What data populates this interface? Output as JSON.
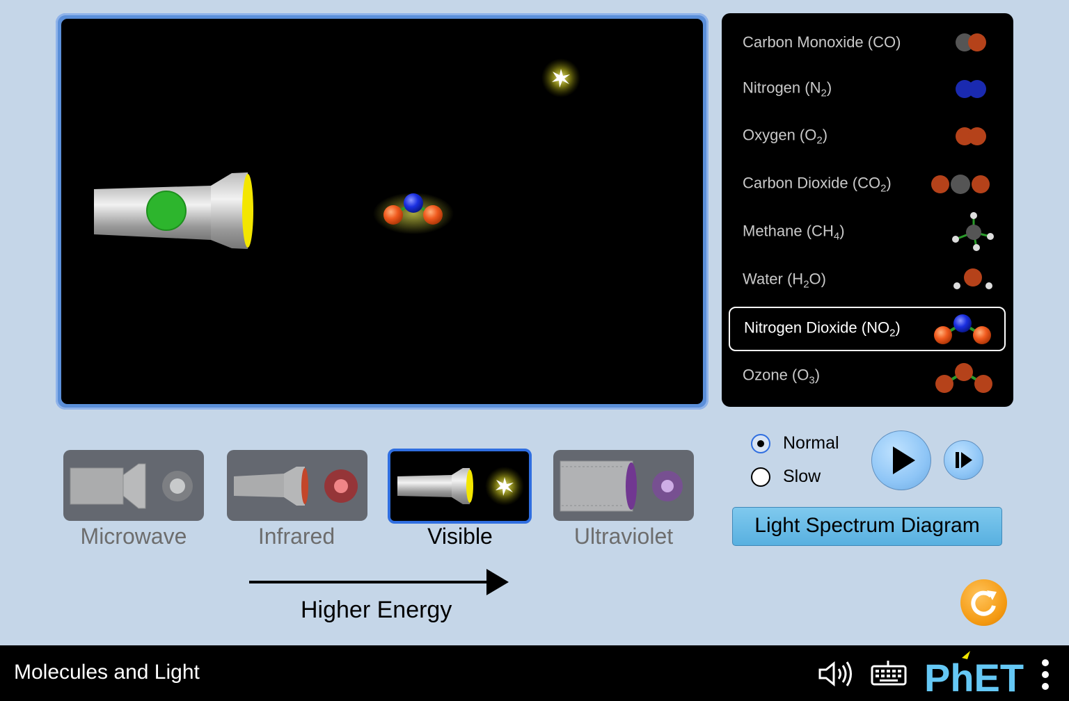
{
  "molecules": [
    {
      "label_main": "Carbon Monoxide (CO)",
      "label_sub": "",
      "label_end": "",
      "selected": false
    },
    {
      "label_main": "Nitrogen (N",
      "label_sub": "2",
      "label_end": ")",
      "selected": false
    },
    {
      "label_main": "Oxygen (O",
      "label_sub": "2",
      "label_end": ")",
      "selected": false
    },
    {
      "label_main": "Carbon Dioxide (CO",
      "label_sub": "2",
      "label_end": ")",
      "selected": false
    },
    {
      "label_main": "Methane (CH",
      "label_sub": "4",
      "label_end": ")",
      "selected": false
    },
    {
      "label_main": "Water (H",
      "label_sub": "2",
      "label_end": "O)",
      "selected": false
    },
    {
      "label_main": "Nitrogen Dioxide (NO",
      "label_sub": "2",
      "label_end": ")",
      "selected": true
    },
    {
      "label_main": "Ozone (O",
      "label_sub": "3",
      "label_end": ")",
      "selected": false
    }
  ],
  "light_sources": [
    {
      "label": "Microwave",
      "selected": false
    },
    {
      "label": "Infrared",
      "selected": false
    },
    {
      "label": "Visible",
      "selected": true
    },
    {
      "label": "Ultraviolet",
      "selected": false
    }
  ],
  "energy_label": "Higher Energy",
  "speed": {
    "normal_label": "Normal",
    "slow_label": "Slow",
    "selected": "Normal"
  },
  "spectrum_button_label": "Light Spectrum Diagram",
  "navbar": {
    "title": "Molecules and Light",
    "brand": "PhET"
  },
  "colors": {
    "background": "#c5d6e8",
    "window_border": "#5b8fd9",
    "selection_border": "#2f6ee0",
    "spectrum_button": "#6bbde8",
    "reset_button": "#f49a12",
    "oxygen_atom": "#f05a1e",
    "nitrogen_atom": "#1a2fe0",
    "carbon_atom": "#555555"
  }
}
